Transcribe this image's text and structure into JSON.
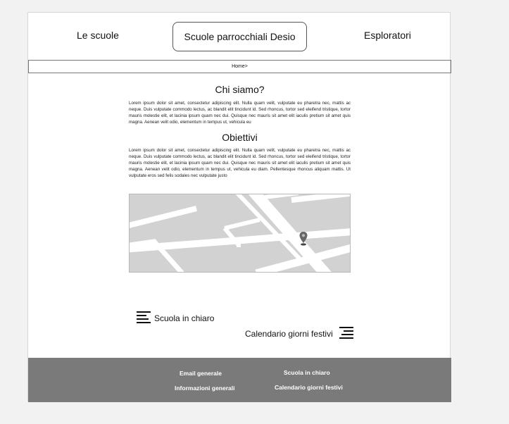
{
  "nav": {
    "items": [
      {
        "label": "Le scuole"
      },
      {
        "label": "Scuole parrocchiali Desio"
      },
      {
        "label": "Esploratori"
      }
    ]
  },
  "breadcrumb": {
    "text": "Home>"
  },
  "sections": [
    {
      "title": "Chi siamo?",
      "body": "Lorem ipsum dolor sit amet, consectetur adipiscing elit. Nulla quam velit, vulputate eu pharetra nec, mattis ac neque. Duis vulputate commodo lectus, ac blandit elit tincidunt id. Sed rhoncus, tortor sed eleifend tristique, tortor mauris molestie elit, et lacinia ipsum quam nec dui. Quisque nec mauris sit amet elit iaculis pretium sit amet quis magna. Aenean velit odio, elementum in tempus ut, vehicula eu"
    },
    {
      "title": "Obiettivi",
      "body": "Lorem ipsum dolor sit amet, consectetur adipiscing elit. Nulla quam velit, vulputate eu pharetra nec, mattis ac neque. Duis vulputate commodo lectus, ac blandit elit tincidunt id. Sed rhoncus, tortor sed eleifend tristique, tortor mauris molestie elit, et lacinia ipsum quam nec dui. Quisque nec mauris sit amet elit iaculis pretium sit amet quis magna. Aenean velit odio, elementum in tempus ut, vehicula eu diam. Pellentesque rhoncus aliquam mattis. Ut vulputate eros sed felis sodales nec vulputate justo"
    }
  ],
  "links": {
    "scuola_in_chiaro": "Scuola in chiaro",
    "calendario": "Calendario giorni festivi"
  },
  "footer": {
    "email": "Email generale",
    "info": "Informazioni generali",
    "scuola_in_chiaro": "Scuola in chiaro",
    "calendario": "Calendario giorni festivi"
  },
  "colors": {
    "footer_bg": "#7a7a7a",
    "map_bg": "#d2d2d2",
    "map_road": "#ffffff",
    "pin": "#555555"
  },
  "icons": [
    "text-lines-icon",
    "map-pin-icon"
  ]
}
